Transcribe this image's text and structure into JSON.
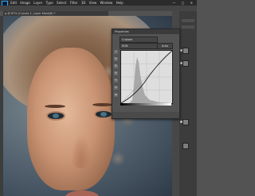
{
  "app": {
    "menu": [
      "Edit",
      "Image",
      "Layer",
      "Type",
      "Select",
      "Filter",
      "3D",
      "View",
      "Window",
      "Help"
    ],
    "window_controls": "— ▢ ✕"
  },
  "document": {
    "tab_label": "g @ 67% (Curves 1, Layer Mask/8) *"
  },
  "properties_panel": {
    "title": "Properties",
    "preset_value": "Custom",
    "channel_value": "RGB",
    "auto_label": "Auto",
    "tool_icons": [
      "pointer-finger-icon",
      "eyedropper-black-icon",
      "eyedropper-gray-icon",
      "eyedropper-white-icon",
      "curve-pencil-icon",
      "smooth-icon",
      "clip-icon"
    ]
  },
  "colors": {
    "ui_dark": "#2b2b2b",
    "panel": "#535353",
    "graph_bg": "#dedede"
  }
}
